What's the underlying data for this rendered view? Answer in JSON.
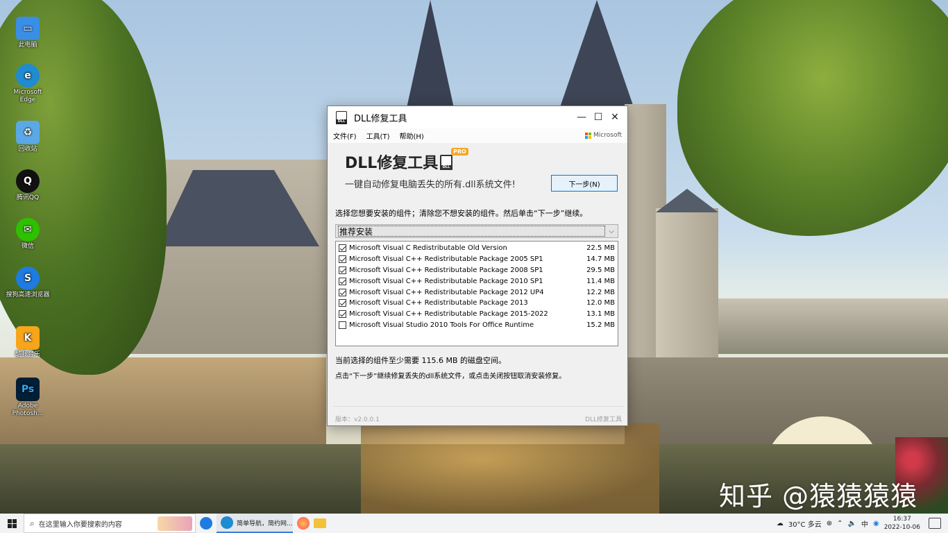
{
  "desktop": {
    "icons": [
      {
        "label": "此电脑",
        "color": "#3a8ee6"
      },
      {
        "label": "Microsoft Edge",
        "color": "#1f8bd0"
      },
      {
        "label": "回收站",
        "color": "#5aa9e6"
      },
      {
        "label": "腾讯QQ",
        "color": "#111111"
      },
      {
        "label": "微信",
        "color": "#2dc100"
      },
      {
        "label": "搜狗高速浏览器",
        "color": "#1e7be0"
      },
      {
        "label": "酷我音乐",
        "color": "#f7a51b"
      },
      {
        "label": "Adobe Photosh...",
        "color": "#001e36"
      }
    ],
    "watermark": "知乎 @猿猿猿猿"
  },
  "window": {
    "title": "DLL修复工具",
    "menu": [
      "文件(F)",
      "工具(T)",
      "帮助(H)"
    ],
    "ms_brand": "Microsoft",
    "header": {
      "title": "DLL修复工具",
      "badge": "PRO",
      "subtitle": "一键自动修复电脑丢失的所有.dll系统文件!",
      "next_button": "下一步(N)"
    },
    "instruction": "选择您想要安装的组件；清除您不想安装的组件。然后单击“下一步”继续。",
    "install_type": "推荐安装",
    "components": [
      {
        "name": "Microsoft Visual C Redistributable Old Version",
        "size": "22.5 MB",
        "checked": true
      },
      {
        "name": "Microsoft Visual C++ Redistributable Package 2005 SP1",
        "size": "14.7 MB",
        "checked": true
      },
      {
        "name": "Microsoft Visual C++ Redistributable Package 2008 SP1",
        "size": "29.5 MB",
        "checked": true
      },
      {
        "name": "Microsoft Visual C++ Redistributable Package 2010 SP1",
        "size": "11.4 MB",
        "checked": true
      },
      {
        "name": "Microsoft Visual C++ Redistributable Package 2012 UP4",
        "size": "12.2 MB",
        "checked": true
      },
      {
        "name": "Microsoft Visual C++ Redistributable Package 2013",
        "size": "12.0 MB",
        "checked": true
      },
      {
        "name": "Microsoft Visual C++ Redistributable Package 2015-2022",
        "size": "13.1 MB",
        "checked": true
      },
      {
        "name": "Microsoft Visual Studio 2010 Tools For Office Runtime",
        "size": "15.2 MB",
        "checked": false
      }
    ],
    "space_required": "当前选择的组件至少需要 115.6 MB 的磁盘空间。",
    "hint": "点击“下一步”继续修复丢失的dll系统文件，或点击关闭按钮取消安装修复。",
    "version": "版本：v2.0.0.1",
    "footer_brand": "DLL修复工具"
  },
  "taskbar": {
    "search_placeholder": "在这里输入你要搜索的内容",
    "edge_task": "简单导航，简约网...",
    "weather": "30°C 多云",
    "tray_lang": "中",
    "time": "16:37",
    "date": "2022-10-06"
  }
}
